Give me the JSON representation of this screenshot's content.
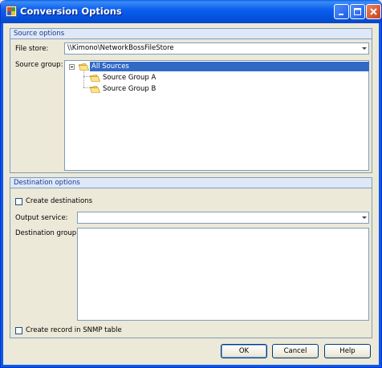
{
  "window": {
    "title": "Conversion Options",
    "controls": [
      "minimize-icon",
      "maximize-icon",
      "close-icon"
    ]
  },
  "source": {
    "group_title": "Source options",
    "file_store_label": "File store:",
    "file_store_value": "\\\\Kimono\\NetworkBossFileStore",
    "source_group_label": "Source group:",
    "tree": [
      {
        "label": "All Sources",
        "selected": true,
        "expanded": true
      },
      {
        "label": "Source Group A"
      },
      {
        "label": "Source Group B"
      }
    ]
  },
  "destination": {
    "group_title": "Destination options",
    "create_destinations_label": "Create destinations",
    "create_destinations_checked": false,
    "output_service_label": "Output service:",
    "output_service_value": "",
    "destination_group_label": "Destination group:",
    "snmp_label": "Create record in SNMP table",
    "snmp_checked": false
  },
  "buttons": {
    "ok": "OK",
    "cancel": "Cancel",
    "help": "Help"
  },
  "colors": {
    "titlebar": "#0654e0",
    "selection": "#316ac5",
    "group_header": "#dfe8f8",
    "dialog_bg": "#ece9d8"
  }
}
